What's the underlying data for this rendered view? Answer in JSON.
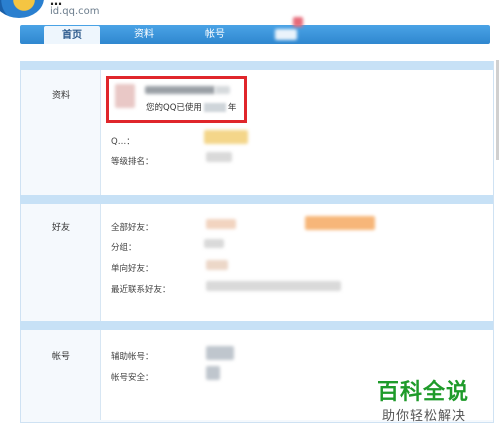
{
  "header": {
    "title": "…",
    "domain": "id.qq.com"
  },
  "nav": {
    "tabs": [
      "首页",
      "资料",
      "帐号"
    ],
    "active": "首页"
  },
  "sections": {
    "profile": {
      "label": "资料",
      "years_prefix": "您的QQ已使用",
      "years_suffix": "年",
      "qq_label": "Q…：",
      "rank_label": "等级排名："
    },
    "friends": {
      "label": "好友",
      "all_friends": "全部好友：",
      "groups": "分组：",
      "one_way": "单向好友：",
      "recent": "最近联系好友："
    },
    "account": {
      "label": "帐号",
      "aux": "辅助帐号：",
      "security": "帐号安全："
    }
  },
  "watermark": {
    "title": "百科全说",
    "subtitle": "助你轻松解决"
  }
}
